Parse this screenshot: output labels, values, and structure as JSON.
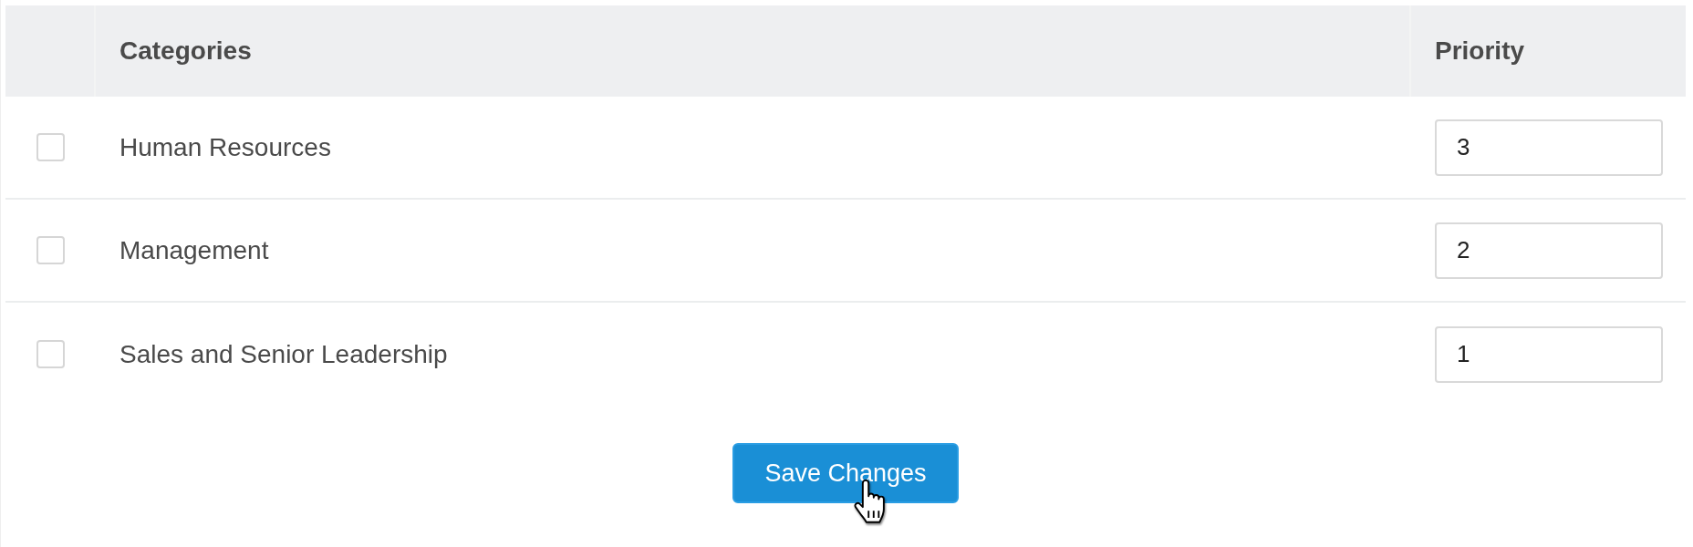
{
  "table": {
    "columns": [
      "Categories",
      "Priority"
    ],
    "rows": [
      {
        "checked": false,
        "category": "Human Resources",
        "priority": "3"
      },
      {
        "checked": false,
        "category": "Management",
        "priority": "2"
      },
      {
        "checked": false,
        "category": "Sales and Senior Leadership",
        "priority": "1"
      }
    ]
  },
  "save_button": {
    "label": "Save Changes"
  }
}
